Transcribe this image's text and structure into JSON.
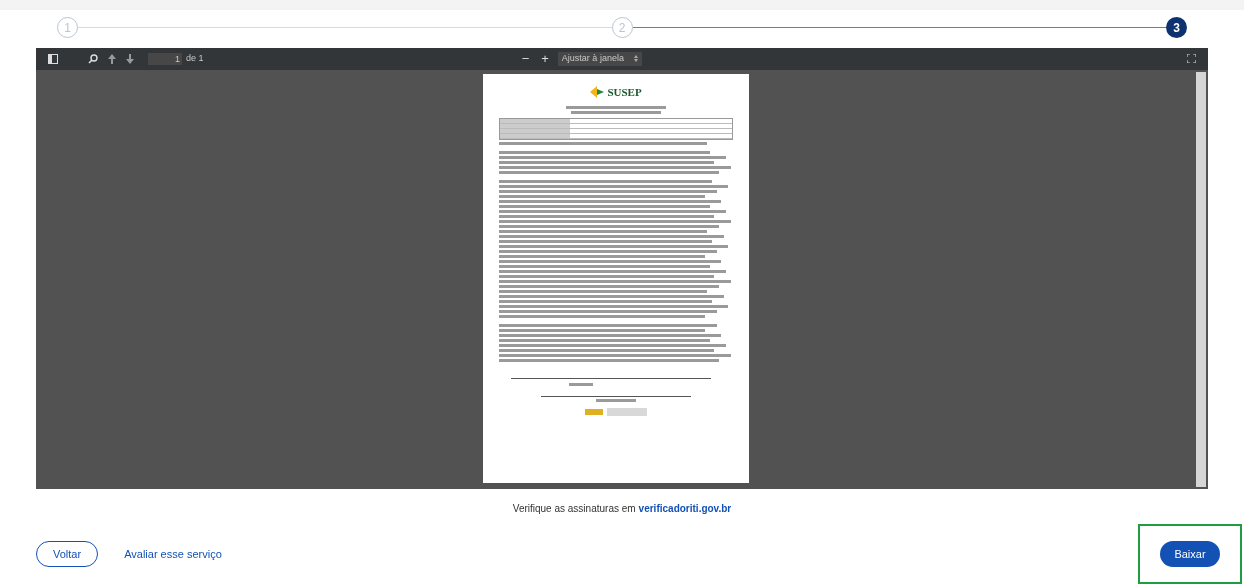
{
  "stepper": [
    {
      "label": "1",
      "selected": false
    },
    {
      "label": "2",
      "selected": false
    },
    {
      "label": "3",
      "selected": true
    }
  ],
  "viewer": {
    "toolbar": {
      "page_value": "1",
      "page_total": "de 1",
      "zoom_minus": "−",
      "zoom_plus": "+",
      "zoom_select": "Ajustar à janela"
    },
    "document": {
      "logo": "SUSEP"
    }
  },
  "verify": {
    "text": "Verifique as assinaturas em",
    "link": "verificadoriti.gov.br"
  },
  "actions": {
    "back": "Voltar",
    "rate": "Avaliar esse serviço",
    "download": "Baixar",
    "download_highlighted": true
  }
}
